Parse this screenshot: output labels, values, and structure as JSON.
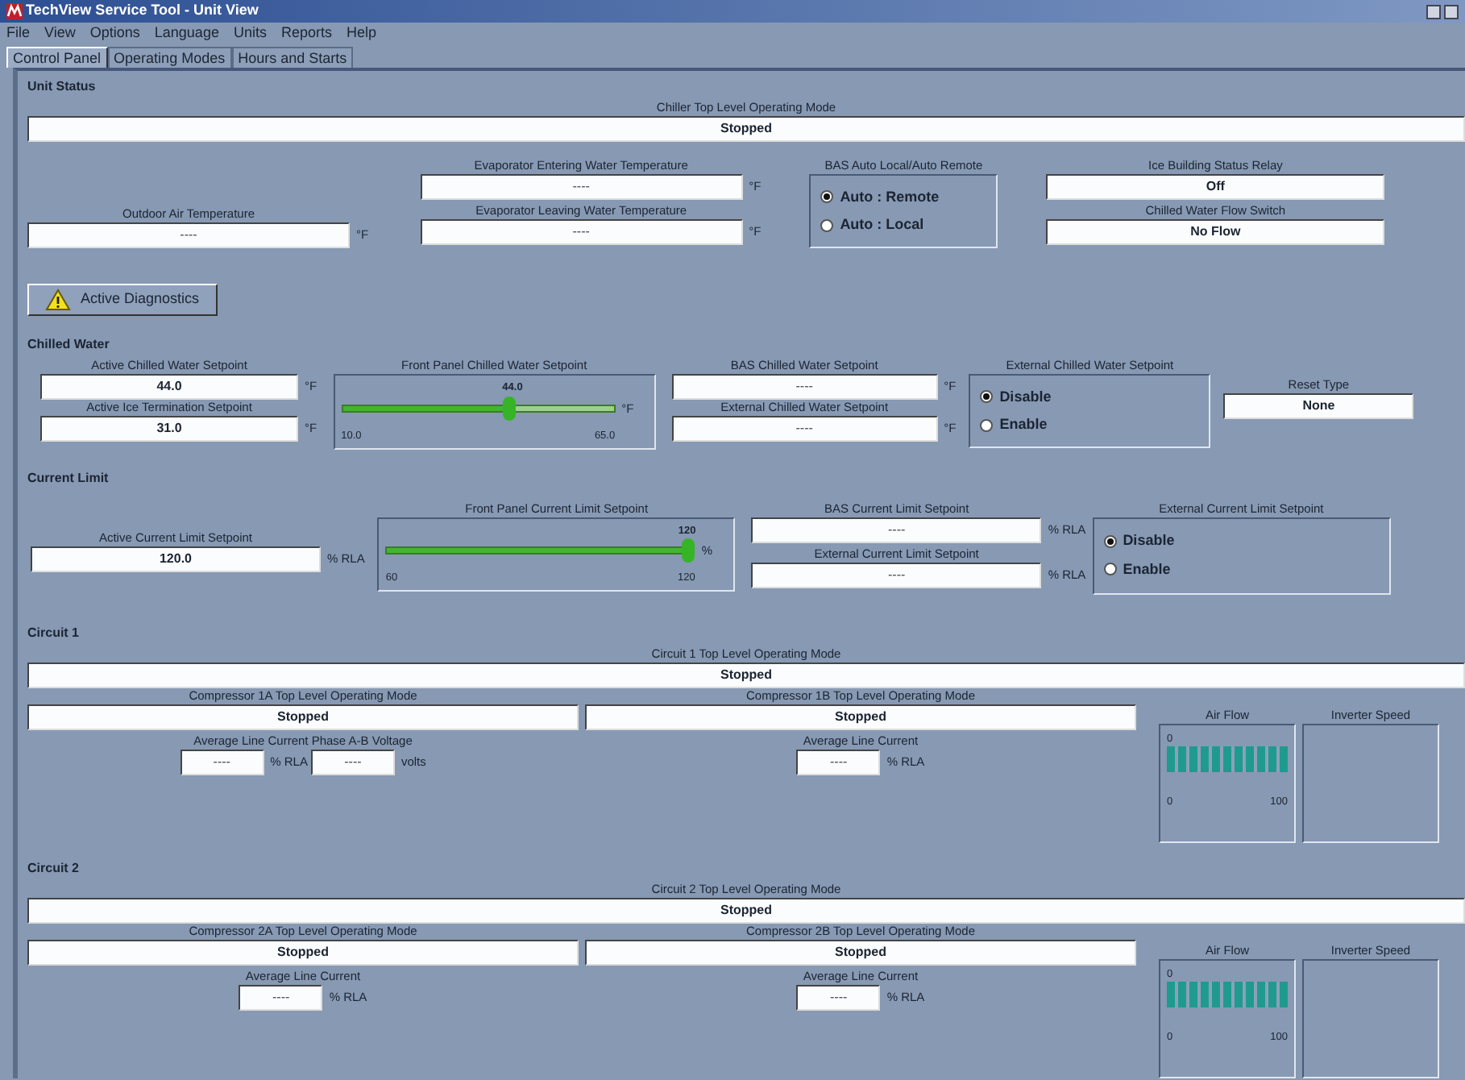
{
  "window": {
    "title": "TechView Service Tool - Unit View"
  },
  "menu": [
    "File",
    "View",
    "Options",
    "Language",
    "Units",
    "Reports",
    "Help"
  ],
  "tabs": [
    {
      "label": "Control Panel",
      "selected": true
    },
    {
      "label": "Operating Modes",
      "selected": false
    },
    {
      "label": "Hours and Starts",
      "selected": false
    }
  ],
  "unit_status": {
    "heading": "Unit Status",
    "chiller_mode": {
      "label": "Chiller Top Level Operating Mode",
      "value": "Stopped"
    },
    "outdoor_air": {
      "label": "Outdoor Air Temperature",
      "value": "----",
      "unit": "°F"
    },
    "evaporator": [
      {
        "label": "Evaporator Entering Water Temperature",
        "value": "----",
        "unit": "°F"
      },
      {
        "label": "Evaporator Leaving Water Temperature",
        "value": "----",
        "unit": "°F"
      }
    ],
    "bas_mode": {
      "label": "BAS Auto Local/Auto Remote",
      "options": [
        {
          "label": "Auto : Remote",
          "selected": true
        },
        {
          "label": "Auto : Local",
          "selected": false
        }
      ]
    },
    "relays": [
      {
        "label": "Ice Building Status Relay",
        "value": "Off"
      },
      {
        "label": "Chilled Water Flow Switch",
        "value": "No Flow"
      }
    ],
    "diagnostics_button": "Active Diagnostics"
  },
  "chilled_water": {
    "heading": "Chilled Water",
    "active": [
      {
        "label": "Active Chilled Water Setpoint",
        "value": "44.0",
        "unit": "°F"
      },
      {
        "label": "Active Ice Termination Setpoint",
        "value": "31.0",
        "unit": "°F"
      }
    ],
    "front_panel": {
      "label": "Front Panel Chilled Water Setpoint",
      "value_label": "44.0",
      "min_label": "10.0",
      "max_label": "65.0",
      "unit": "°F",
      "level": 0.62
    },
    "external": [
      {
        "label": "BAS Chilled Water Setpoint",
        "value": "----",
        "unit": "°F"
      },
      {
        "label": "External Chilled Water Setpoint",
        "value": "----",
        "unit": "°F"
      }
    ],
    "external_enable": {
      "label": "External Chilled Water Setpoint",
      "options": [
        {
          "label": "Disable",
          "selected": true
        },
        {
          "label": "Enable",
          "selected": false
        }
      ]
    },
    "reset_type": {
      "label": "Reset Type",
      "value": "None"
    }
  },
  "current_limit": {
    "heading": "Current Limit",
    "active": {
      "label": "Active Current Limit Setpoint",
      "value": "120.0",
      "unit": "% RLA"
    },
    "front_panel": {
      "label": "Front Panel Current Limit Setpoint",
      "value_label": "120",
      "min_label": "60",
      "max_label": "120",
      "unit": "%",
      "level": 1
    },
    "external": [
      {
        "label": "BAS Current Limit Setpoint",
        "value": "----",
        "unit": "% RLA"
      },
      {
        "label": "External Current Limit Setpoint",
        "value": "----",
        "unit": "% RLA"
      }
    ],
    "external_enable": {
      "label": "External Current Limit Setpoint",
      "options": [
        {
          "label": "Disable",
          "selected": true
        },
        {
          "label": "Enable",
          "selected": false
        }
      ]
    }
  },
  "circuits": [
    {
      "heading": "Circuit 1",
      "mode": {
        "label": "Circuit 1 Top Level Operating Mode",
        "value": "Stopped"
      },
      "compressors": [
        {
          "label": "Compressor 1A Top Level Operating Mode",
          "value": "Stopped",
          "current_label": "Average Line Current Phase A-B Voltage",
          "readings": [
            {
              "value": "----",
              "unit": "% RLA"
            },
            {
              "value": "----",
              "unit": "volts"
            }
          ]
        },
        {
          "label": "Compressor 1B Top Level Operating Mode",
          "value": "Stopped",
          "current_label": "Average Line Current",
          "readings": [
            {
              "value": "----",
              "unit": "% RLA"
            }
          ]
        }
      ],
      "air_flow": {
        "label": "Air Flow",
        "reading": "0",
        "min_label": "0",
        "max_label": "100",
        "level": 1
      },
      "inverter": {
        "label": "Inverter Speed"
      }
    },
    {
      "heading": "Circuit 2",
      "mode": {
        "label": "Circuit 2 Top Level Operating Mode",
        "value": "Stopped"
      },
      "compressors": [
        {
          "label": "Compressor 2A Top Level Operating Mode",
          "value": "Stopped",
          "current_label": "Average Line Current",
          "readings": [
            {
              "value": "----",
              "unit": "% RLA"
            }
          ]
        },
        {
          "label": "Compressor 2B Top Level Operating Mode",
          "value": "Stopped",
          "current_label": "Average Line Current",
          "readings": [
            {
              "value": "----",
              "unit": "% RLA"
            }
          ]
        }
      ],
      "air_flow": {
        "label": "Air Flow",
        "reading": "0",
        "min_label": "0",
        "max_label": "100",
        "level": 1
      },
      "inverter": {
        "label": "Inverter Speed"
      }
    }
  ]
}
